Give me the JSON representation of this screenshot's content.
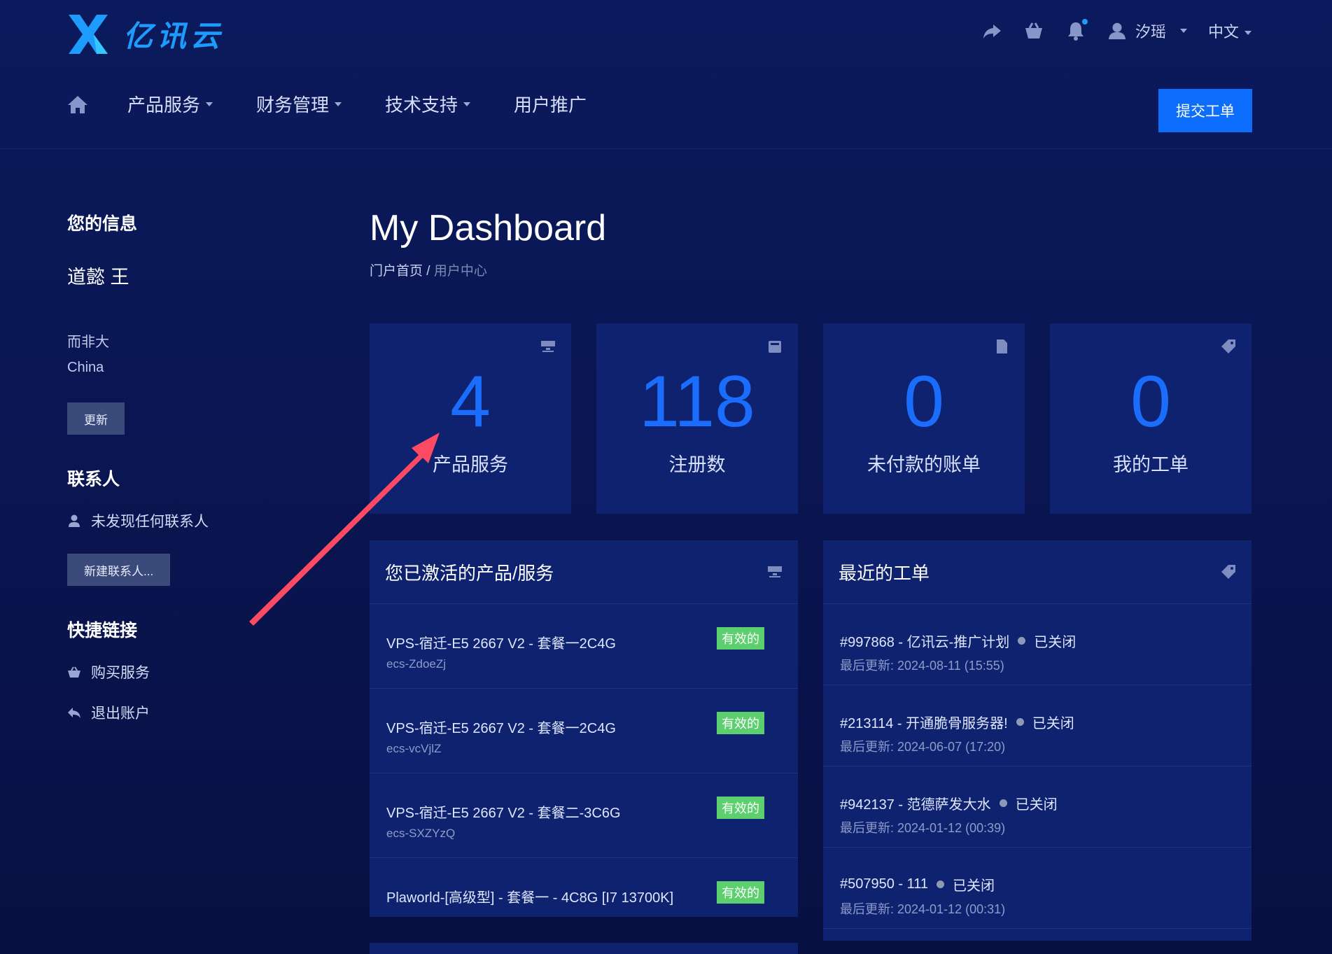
{
  "brand": {
    "name": "亿讯云",
    "accent": "#1e9bff"
  },
  "header": {
    "user_name": "汐瑶",
    "language": "中文",
    "icons": [
      "share-icon",
      "basket-icon",
      "bell-icon",
      "user-icon"
    ]
  },
  "nav": {
    "items": [
      {
        "label": "产品服务",
        "dropdown": true
      },
      {
        "label": "财务管理",
        "dropdown": true
      },
      {
        "label": "技术支持",
        "dropdown": true
      },
      {
        "label": "用户推广",
        "dropdown": false
      }
    ],
    "submit_ticket": "提交工单"
  },
  "sidebar": {
    "info_title": "您的信息",
    "user_full_name": "道懿 王",
    "address_line1": "而非大",
    "address_line2": "China",
    "update_button": "更新",
    "contacts_title": "联系人",
    "no_contacts": "未发现任何联系人",
    "new_contact_button": "新建联系人...",
    "quick_links_title": "快捷链接",
    "quick_links": [
      {
        "label": "购买服务",
        "icon": "basket-icon"
      },
      {
        "label": "退出账户",
        "icon": "reply-icon"
      }
    ]
  },
  "main": {
    "title": "My Dashboard",
    "breadcrumb": {
      "home": "门户首页",
      "separator": "/",
      "current": "用户中心"
    }
  },
  "stats": [
    {
      "value": "4",
      "label": "产品服务",
      "icon": "server-icon"
    },
    {
      "value": "118",
      "label": "注册数",
      "icon": "domain-icon"
    },
    {
      "value": "0",
      "label": "未付款的账单",
      "icon": "invoice-icon"
    },
    {
      "value": "0",
      "label": "我的工单",
      "icon": "ticket-icon"
    }
  ],
  "products_panel": {
    "title": "您已激活的产品/服务",
    "items": [
      {
        "name": "VPS-宿迁-E5 2667 V2 - 套餐一2C4G",
        "sub": "ecs-ZdoeZj",
        "status": "有效的"
      },
      {
        "name": "VPS-宿迁-E5 2667 V2 - 套餐一2C4G",
        "sub": "ecs-vcVjlZ",
        "status": "有效的"
      },
      {
        "name": "VPS-宿迁-E5 2667 V2 - 套餐二-3C6G",
        "sub": "ecs-SXZYzQ",
        "status": "有效的"
      },
      {
        "name": "Plaworld-[高级型] - 套餐一 - 4C8G [I7 13700K]",
        "sub": "",
        "status": "有效的"
      }
    ]
  },
  "tickets_panel": {
    "title": "最近的工单",
    "items": [
      {
        "name": "#997868 - 亿讯云-推广计划",
        "status": "已关闭",
        "updated": "最后更新: 2024-08-11 (15:55)"
      },
      {
        "name": "#213114 - 开通脆骨服务器!",
        "status": "已关闭",
        "updated": "最后更新: 2024-06-07 (17:20)"
      },
      {
        "name": "#942137 - 范德萨发大水",
        "status": "已关闭",
        "updated": "最后更新: 2024-01-12 (00:39)"
      },
      {
        "name": "#507950 - 111",
        "status": "已关闭",
        "updated": "最后更新: 2024-01-12 (00:31)"
      }
    ]
  },
  "annotation": {
    "color": "#ff4a63"
  }
}
